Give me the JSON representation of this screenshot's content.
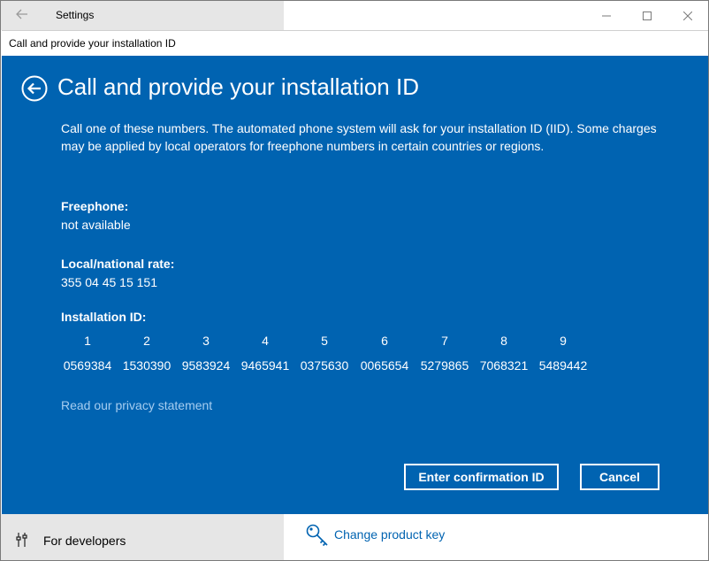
{
  "settings": {
    "title": "Settings",
    "for_developers": "For developers",
    "change_product_key": "Change product key"
  },
  "dialog": {
    "window_title": "Call and provide your installation ID",
    "heading": "Call and provide your installation ID",
    "description": "Call one of these numbers. The automated phone system will ask for your installation ID (IID). Some charges may be applied by local operators for freephone numbers in certain countries or regions.",
    "freephone_label": "Freephone:",
    "freephone_value": "not available",
    "local_label": "Local/national rate:",
    "local_value": "355 04 45 15 151",
    "iid_label": "Installation ID:",
    "iid_groups": [
      "1",
      "2",
      "3",
      "4",
      "5",
      "6",
      "7",
      "8",
      "9"
    ],
    "iid_values": [
      "0569384",
      "1530390",
      "9583924",
      "9465941",
      "0375630",
      "0065654",
      "5279865",
      "7068321",
      "5489442"
    ],
    "privacy_link": "Read our privacy statement",
    "confirm_button": "Enter confirmation ID",
    "cancel_button": "Cancel"
  },
  "colors": {
    "accent": "#0063b1",
    "link": "#a6cdf0"
  }
}
